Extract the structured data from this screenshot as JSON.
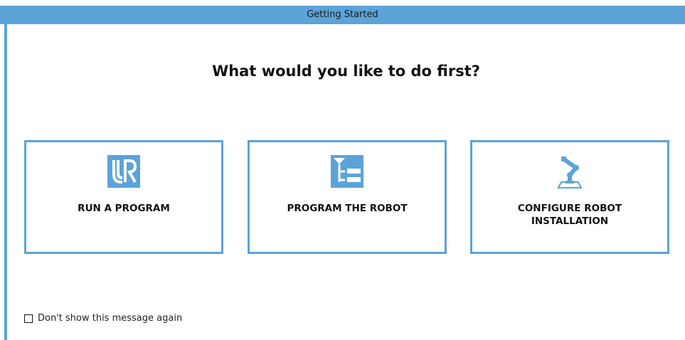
{
  "window": {
    "title": "Getting Started"
  },
  "main": {
    "heading": "What would you like to do first?",
    "options": [
      {
        "label": "RUN A PROGRAM",
        "icon": "ur-logo-icon"
      },
      {
        "label": "PROGRAM THE ROBOT",
        "icon": "program-tree-icon"
      },
      {
        "label": "CONFIGURE ROBOT\nINSTALLATION",
        "icon": "robot-arm-icon"
      }
    ]
  },
  "footer": {
    "checkbox_label": "Don't show this message again",
    "checkbox_checked": false
  },
  "colors": {
    "accent": "#5ba3d9",
    "text": "#111111",
    "background": "#ffffff"
  }
}
